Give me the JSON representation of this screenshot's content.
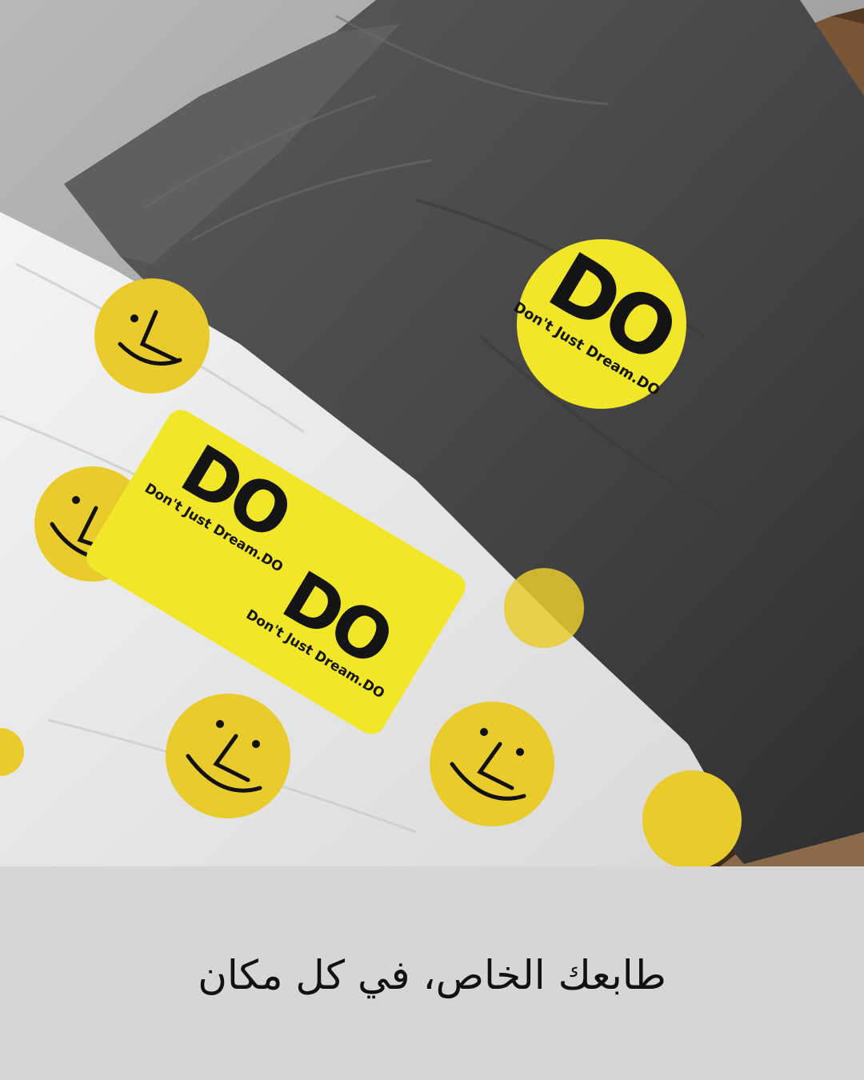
{
  "colors": {
    "sticker_yellow": "#f2e629",
    "smiley_yellow": "#e9cb2b",
    "dark_paper": "#4a4a4a",
    "light_paper": "#ececec",
    "box": "#5a3a24",
    "caption_bg": "#d6d6d6"
  },
  "stickers": {
    "logo": "DO",
    "tagline": "Don't Just Dream.DO"
  },
  "caption": "طابعك الخاص، في كل مكان"
}
